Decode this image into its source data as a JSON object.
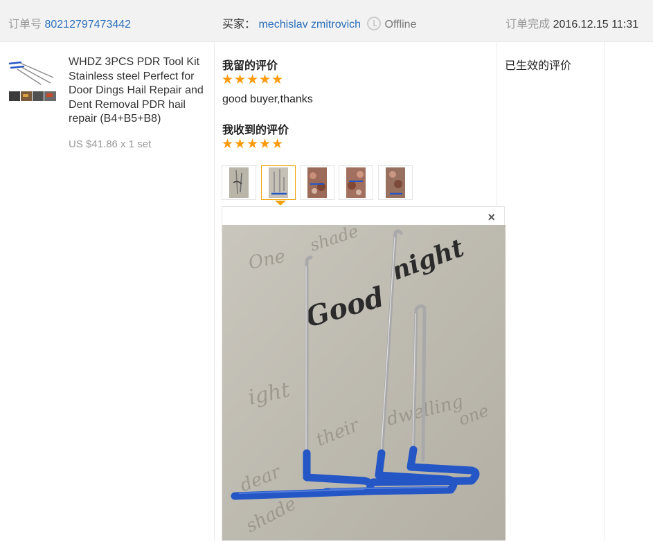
{
  "header": {
    "order_label": "订单号",
    "order_number": "80212797473442",
    "buyer_label": "买家：",
    "buyer_name": "mechislav zmitrovich",
    "buyer_status": "Offline",
    "complete_label": "订单完成",
    "complete_time": "2016.12.15 11:31"
  },
  "product": {
    "title": "WHDZ 3PCS PDR Tool Kit Stainless steel Perfect for Door Dings Hail Repair and Dent Removal PDR hail repair (B4+B5+B8)",
    "price": "US $41.86 x 1 set"
  },
  "my_review": {
    "heading": "我留的评价",
    "rating": 5,
    "stars": [
      "★",
      "★",
      "★",
      "★",
      "★"
    ],
    "text": "good buyer,thanks"
  },
  "received_review": {
    "heading": "我收到的评价",
    "rating": 5,
    "stars": [
      "★",
      "★",
      "★",
      "★",
      "★"
    ],
    "photo_count": 5,
    "selected_photo": 2
  },
  "viewer": {
    "close_label": "×",
    "photo_texts": [
      "One",
      "shade",
      "Good",
      "night",
      "ight",
      "dwelling",
      "their",
      "one",
      "dear",
      "shade"
    ]
  },
  "status_column": {
    "label": "已生效的评价"
  },
  "colors": {
    "accent_link": "#2a6ebb",
    "star": "#ff9a0e",
    "selected_border": "#f0a20b",
    "tool_blue": "#2456c6"
  }
}
